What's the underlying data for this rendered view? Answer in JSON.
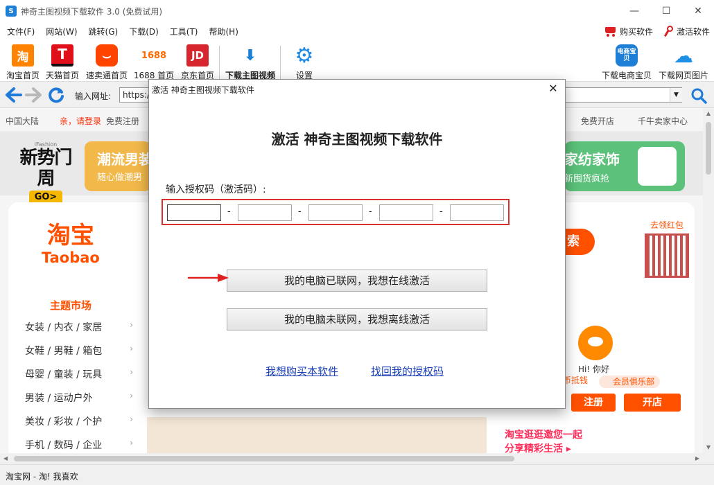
{
  "window": {
    "title": "神奇主图视频下载软件 3.0 (免费试用)",
    "app_icon_glyph": "S",
    "controls": {
      "minimize": "—",
      "maximize": "☐",
      "close": "✕"
    }
  },
  "menubar": {
    "items": [
      {
        "label": "文件(F)"
      },
      {
        "label": "网站(W)"
      },
      {
        "label": "跳转(G)"
      },
      {
        "label": "下载(D)"
      },
      {
        "label": "工具(T)"
      },
      {
        "label": "帮助(H)"
      }
    ],
    "buy_label": "购买软件",
    "activate_label": "激活软件"
  },
  "toolbar": {
    "items": [
      {
        "label": "淘宝首页",
        "glyph": "淘",
        "icon": "taobao-icon",
        "color": "#ff8200"
      },
      {
        "label": "天猫首页",
        "glyph": "T",
        "icon": "tmall-icon",
        "color": "#e0101a"
      },
      {
        "label": "速卖通首页",
        "glyph": "⌣",
        "icon": "aliexpress-icon",
        "color": "#ff4400"
      },
      {
        "label": "1688 首页",
        "glyph": "1688",
        "icon": "1688-icon",
        "color": "#ff6a00"
      },
      {
        "label": "京东首页",
        "glyph": "JD",
        "icon": "jd-icon",
        "color": "#d8262f"
      },
      {
        "label": "下载主图视频",
        "glyph": "⬇",
        "icon": "download-video-icon",
        "color": "#1a7fd6"
      },
      {
        "label": "设置",
        "glyph": "⚙",
        "icon": "settings-gear-icon",
        "color": "#1a8ae6"
      }
    ],
    "right_items": [
      {
        "label": "下载电商宝贝",
        "glyph": "电商宝贝",
        "icon": "ecommerce-download-icon",
        "color": "#1e7fd6"
      },
      {
        "label": "下载网页图片",
        "glyph": "☁",
        "icon": "cloud-download-icon",
        "color": "#1e90e6"
      }
    ]
  },
  "addressbar": {
    "label": "输入网址:",
    "value": "https:/"
  },
  "site": {
    "region": "中国大陆",
    "login_prompt": "亲，请登录",
    "register": "免费注册",
    "top_right_1": "免费开店",
    "top_right_2": "千牛卖家中心",
    "fashion_small": "iFashion",
    "fashion_big": "新势门周",
    "fashion_go": "GO>",
    "banner1_title": "潮流男装",
    "banner1_sub": "随心做潮男",
    "banner2_title": "家纺家饰",
    "banner2_sub": "新囤货疯抢",
    "logo_cn": "淘宝",
    "logo_en": "Taobao",
    "market_title": "主题市场",
    "categories": [
      {
        "label": "女装 / 内衣 / 家居"
      },
      {
        "label": "女鞋 / 男鞋 / 箱包"
      },
      {
        "label": "母婴 / 童装 / 玩具"
      },
      {
        "label": "男装 / 运动户外"
      },
      {
        "label": "美妆 / 彩妆 / 个护"
      },
      {
        "label": "手机 / 数码 / 企业"
      }
    ],
    "search_btn": "索",
    "red_packet": "去领红包",
    "hi": "Hi! 你好",
    "coin": "币抵钱",
    "member": "会员俱乐部",
    "register_btn": "注册",
    "open_shop_btn": "开店",
    "promo_line1": "淘宝逛逛邀您一起",
    "promo_line2": "分享精彩生活 ▸"
  },
  "statusbar": {
    "text": "淘宝网 - 淘! 我喜欢"
  },
  "dialog": {
    "title": "激活 神奇主图视频下载软件",
    "heading": "激活 神奇主图视频下载软件",
    "code_label": "输入授权码（激活码）:",
    "code_fields": [
      "",
      "",
      "",
      "",
      ""
    ],
    "dash": "-",
    "online_button": "我的电脑已联网，我想在线激活",
    "offline_button": "我的电脑未联网，我想离线激活",
    "buy_link": "我想购买本软件",
    "retrieve_link": "找回我的授权码",
    "close_glyph": "✕"
  }
}
